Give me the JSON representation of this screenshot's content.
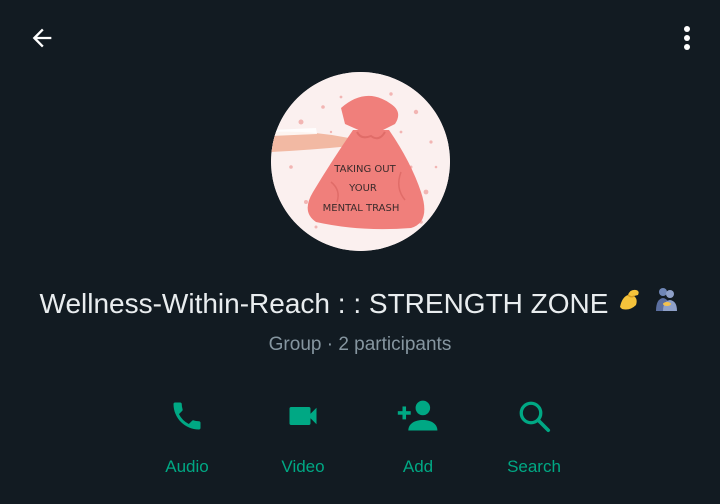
{
  "group": {
    "name": "Wellness-Within-Reach : : STRENGTH ZONE",
    "meta": "Group · 2 participants",
    "avatar_text": [
      "TAKING OUT",
      "YOUR",
      "MENTAL TRASH"
    ]
  },
  "actions": [
    {
      "label": "Audio",
      "icon": "phone-icon"
    },
    {
      "label": "Video",
      "icon": "video-camera-icon"
    },
    {
      "label": "Add",
      "icon": "add-person-icon"
    },
    {
      "label": "Search",
      "icon": "search-icon"
    }
  ],
  "colors": {
    "background": "#121b22",
    "accent": "#00a884",
    "primary_text": "#e9edef",
    "secondary_text": "#8696a0"
  }
}
